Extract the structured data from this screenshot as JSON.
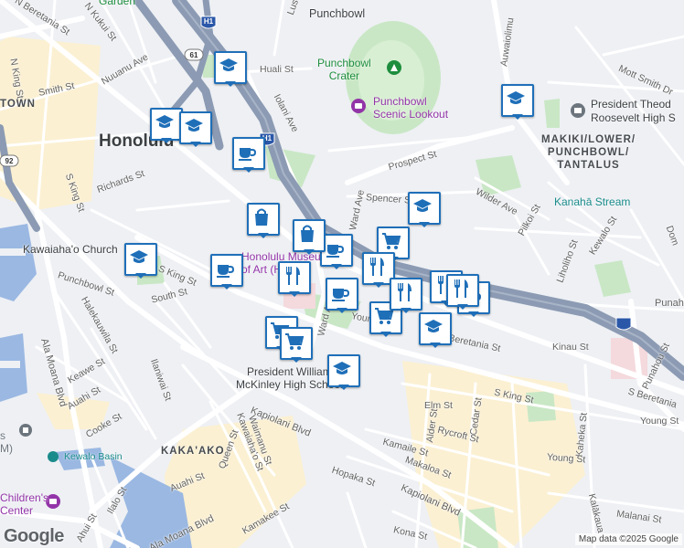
{
  "map": {
    "branding": "Google",
    "attribution": "Map data ©2025 Google",
    "city_label": "Honolulu",
    "area_labels": [
      "TOWN",
      "MAKIKI/LOWER/\nPUNCHBOWL/\nTANTALUS",
      "KAKA'AKO"
    ],
    "poi_labels": {
      "garden": "Garden",
      "punchbowl": "Punchbowl",
      "punchbowl_crater": "Punchbowl\nCrater",
      "punchbowl_lookout": "Punchbowl\nScenic Lookout",
      "roosevelt": "President Theod\nRoosevelt High S",
      "kawaiahao": "Kawaiaha'o Church",
      "museum": "Honolulu Museum\nof Art (HoMA)",
      "mckinley": "President William\nMcKinley High School",
      "kanaha": "Kanahā Stream",
      "kewalo_basin": "Kewalo Basin",
      "childrens": "Children's\nCenter",
      "m_fragment": "s\nM)"
    },
    "street_labels": [
      "N Beretania St",
      "N Kukui St",
      "Nuuanu Ave",
      "N King St",
      "Smith St",
      "Huali St",
      "Iolani Ave",
      "Prospect St",
      "Auwaiolimu",
      "Mott Smith Dr",
      "S King St",
      "Richards St",
      "Spencer St",
      "Ward Ave",
      "Wilder Ave",
      "Pilkoi St",
      "Kewalo St",
      "Liholiho St",
      "Punchbowl St",
      "South St",
      "Halekauwila St",
      "S King St",
      "Kinau St",
      "Beretania St",
      "Punahou St",
      "S Beretania",
      "Young St",
      "Elm St",
      "Alder St",
      "Cedar St",
      "Rycroft St",
      "S King St",
      "Kaheka St",
      "Kamaile St",
      "Makaloa St",
      "Kapiolani Blvd",
      "Ilaniwai St",
      "Keawe St",
      "Auahi St",
      "Cooke St",
      "Queen St",
      "Kawaiaha'o St",
      "Waimanu St",
      "Auahi St",
      "Kamakee St",
      "Ala Moana Blvd",
      "Ilalo St",
      "Ahui St",
      "Kona St",
      "Hopaka St",
      "Kapiolani Blvd",
      "Ala Moana Blvd",
      "Malanai St",
      "Kalākaua",
      "Young St",
      "Lus",
      "Dom",
      "Punahou",
      "Youn",
      "Ward Ave"
    ],
    "highway_labels": [
      "H1",
      "H1",
      "61",
      "92"
    ],
    "markers": [
      {
        "type": "school-icon"
      },
      {
        "type": "school-icon"
      },
      {
        "type": "school-icon"
      },
      {
        "type": "school-icon"
      },
      {
        "type": "school-icon"
      },
      {
        "type": "school-icon"
      },
      {
        "type": "school-icon"
      },
      {
        "type": "school-icon"
      },
      {
        "type": "cafe-icon"
      },
      {
        "type": "cafe-icon"
      },
      {
        "type": "cafe-icon"
      },
      {
        "type": "cafe-icon"
      },
      {
        "type": "cafe-icon"
      },
      {
        "type": "shopping-bag-icon"
      },
      {
        "type": "shopping-bag-icon"
      },
      {
        "type": "shopping-cart-icon"
      },
      {
        "type": "shopping-cart-icon"
      },
      {
        "type": "shopping-cart-icon"
      },
      {
        "type": "shopping-cart-icon"
      },
      {
        "type": "restaurant-icon"
      },
      {
        "type": "restaurant-icon"
      },
      {
        "type": "restaurant-icon"
      },
      {
        "type": "restaurant-icon"
      },
      {
        "type": "restaurant-icon"
      }
    ],
    "colors": {
      "marker_border": "#1f6fb8",
      "freeway": "#8c9bb3",
      "water": "#9ab8e2",
      "park": "#c9e7c5",
      "commercial": "#fbf0d2"
    }
  }
}
